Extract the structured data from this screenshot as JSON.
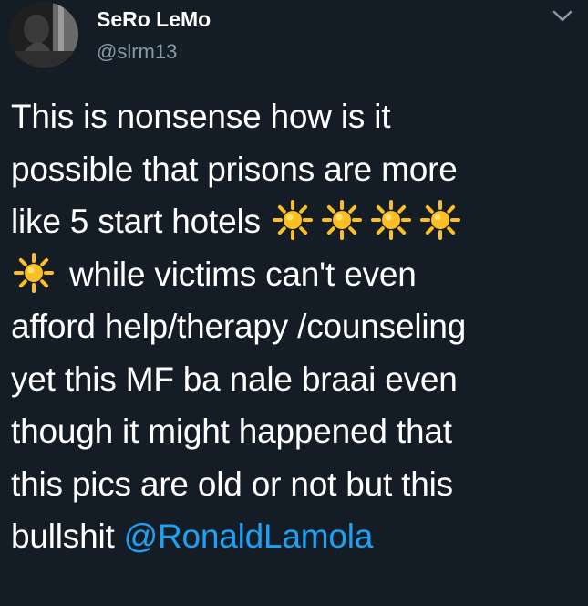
{
  "tweet": {
    "display_name": "SeRo LeMo",
    "handle": "@slrm13",
    "text_lines": [
      "This is nonsense how is it",
      "possible that prisons are more",
      "like 5 start hotels",
      "while victims can't even",
      "afford help/therapy /counseling",
      "yet this MF ba nale braai even",
      "though it might happened that",
      "this pics are old or not but this",
      "bullshit"
    ],
    "mention": "@RonaldLamola",
    "emoji": "sun-emoji",
    "emoji_color": "#fbbf24",
    "accent_color": "#1da1f2",
    "background_color": "#141d26"
  }
}
